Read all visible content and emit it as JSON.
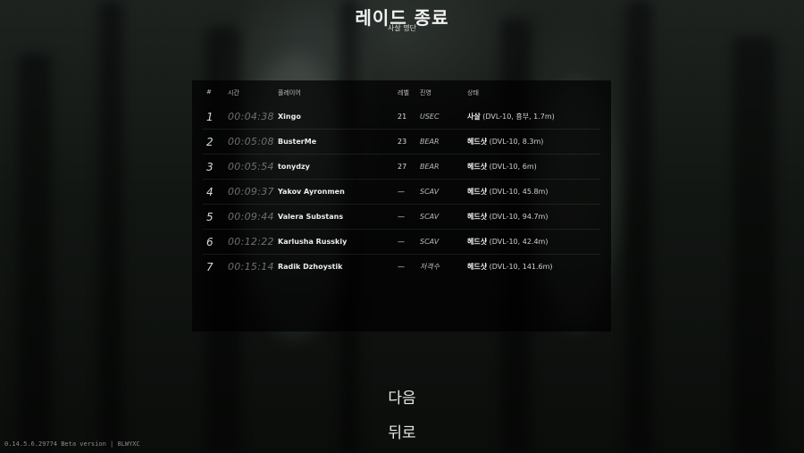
{
  "header": {
    "title": "레이드 종료",
    "subtitle": "사살 명단"
  },
  "table": {
    "columns": {
      "num": "#",
      "time": "시간",
      "player": "플레이어",
      "level": "레벨",
      "side": "진영",
      "status": "상태"
    },
    "rows": [
      {
        "num": "1",
        "time": "00:04:38",
        "player": "Xingo",
        "level": "21",
        "side": "USEC",
        "status_type": "사살",
        "status_detail": "(DVL-10, 흉부, 1.7m)"
      },
      {
        "num": "2",
        "time": "00:05:08",
        "player": "BusterMe",
        "level": "23",
        "side": "BEAR",
        "status_type": "헤드샷",
        "status_detail": "(DVL-10, 8.3m)"
      },
      {
        "num": "3",
        "time": "00:05:54",
        "player": "tonydzy",
        "level": "27",
        "side": "BEAR",
        "status_type": "헤드샷",
        "status_detail": "(DVL-10, 6m)"
      },
      {
        "num": "4",
        "time": "00:09:37",
        "player": "Yakov Ayronmen",
        "level": "—",
        "side": "SCAV",
        "status_type": "헤드샷",
        "status_detail": "(DVL-10, 45.8m)"
      },
      {
        "num": "5",
        "time": "00:09:44",
        "player": "Valera Substans",
        "level": "—",
        "side": "SCAV",
        "status_type": "헤드샷",
        "status_detail": "(DVL-10, 94.7m)"
      },
      {
        "num": "6",
        "time": "00:12:22",
        "player": "Karlusha Russkiy",
        "level": "—",
        "side": "SCAV",
        "status_type": "헤드샷",
        "status_detail": "(DVL-10, 42.4m)"
      },
      {
        "num": "7",
        "time": "00:15:14",
        "player": "Radik Dzhoystik",
        "level": "—",
        "side": "저격수",
        "status_type": "헤드샷",
        "status_detail": "(DVL-10, 141.6m)"
      }
    ]
  },
  "buttons": {
    "next": "다음",
    "back": "뒤로"
  },
  "footer": {
    "version": "0.14.5.6.29774 Beta version | 8LWYXC"
  }
}
